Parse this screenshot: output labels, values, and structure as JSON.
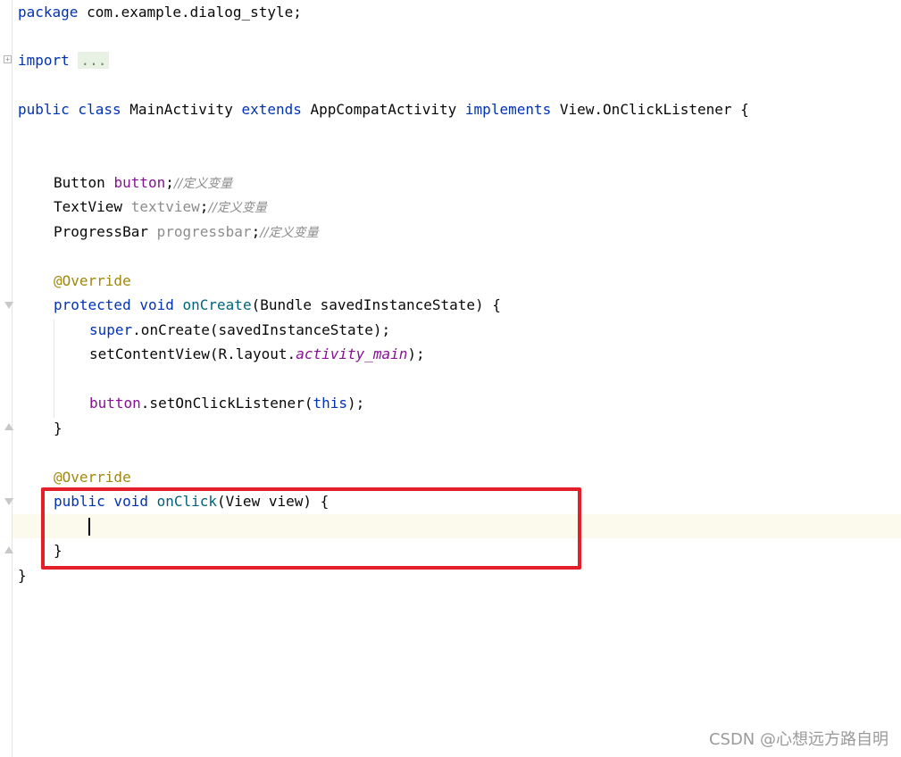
{
  "editor": {
    "lines": {
      "package_kw": "package",
      "package_name": " com.example.dialog_style;",
      "import_kw": "import",
      "import_folded": "...",
      "class_public": "public",
      "class_class": " class",
      "class_name": " MainActivity",
      "class_extends": " extends",
      "class_super": " AppCompatActivity",
      "class_implements": " implements",
      "class_iface": " View.OnClickListener {",
      "btn_type": "Button ",
      "btn_name": "button",
      "btn_semi": ";",
      "btn_comment": "//定义变量",
      "tv_type": "TextView ",
      "tv_name": "textview",
      "tv_semi": ";",
      "tv_comment": "//定义变量",
      "pb_type": "ProgressBar ",
      "pb_name": "progressbar",
      "pb_semi": ";",
      "pb_comment": "//定义变量",
      "override1": "@Override",
      "oncreate_protected": "protected",
      "oncreate_void": " void",
      "oncreate_name": " onCreate",
      "oncreate_params": "(Bundle savedInstanceState) {",
      "super_kw": "super",
      "super_call": ".onCreate(savedInstanceState);",
      "setcv_start": "setContentView(R.layout.",
      "setcv_layout": "activity_main",
      "setcv_end": ");",
      "listener_field": "button",
      "listener_call": ".setOnClickListener(",
      "listener_this": "this",
      "listener_end": ");",
      "close_brace_1": "}",
      "override2": "@Override",
      "onclick_public": "public",
      "onclick_void": " void",
      "onclick_name": " onClick",
      "onclick_params": "(View view) {",
      "close_brace_2": "}",
      "close_brace_class": "}"
    }
  },
  "watermark": "CSDN @心想远方路自明",
  "colors": {
    "keyword": "#0033b3",
    "field": "#871094",
    "comment": "#8c8c8c",
    "annotation": "#9e880d",
    "method": "#00627a",
    "highlight_box": "#e3202a"
  }
}
